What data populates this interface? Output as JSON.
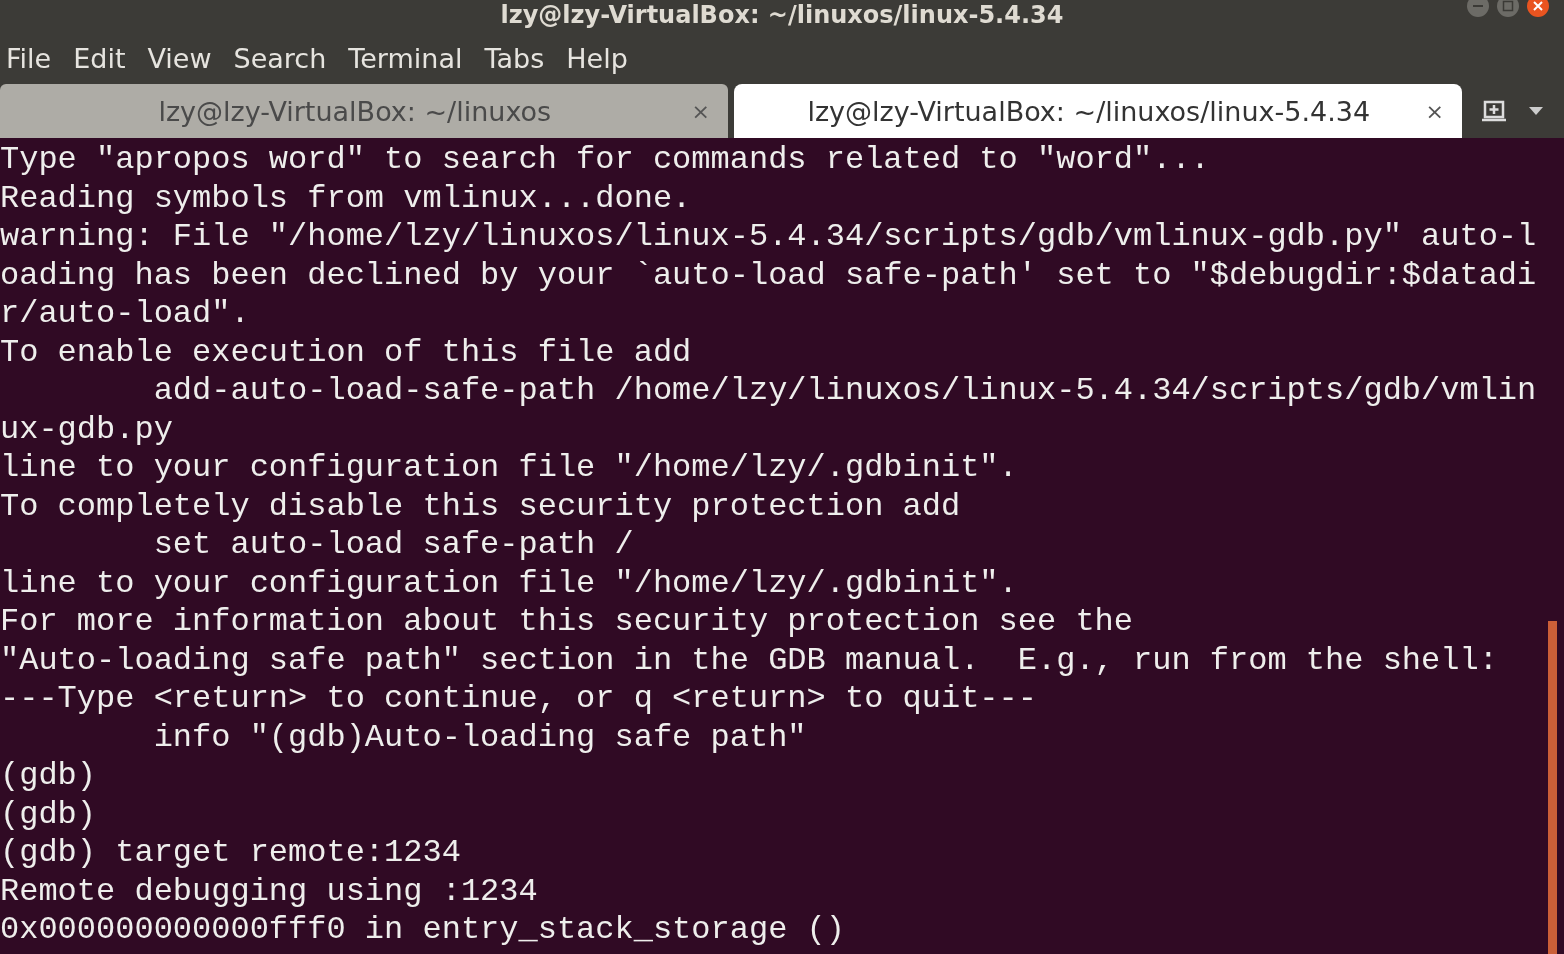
{
  "window": {
    "title": "lzy@lzy-VirtualBox: ~/linuxos/linux-5.4.34"
  },
  "menu": [
    "File",
    "Edit",
    "View",
    "Search",
    "Terminal",
    "Tabs",
    "Help"
  ],
  "tabs": [
    {
      "label": "lzy@lzy-VirtualBox: ~/linuxos",
      "close": "×",
      "selected": false
    },
    {
      "label": "lzy@lzy-VirtualBox: ~/linuxos/linux-5.4.34",
      "close": "×",
      "selected": true
    }
  ],
  "terminal": {
    "lines": [
      "Type \"apropos word\" to search for commands related to \"word\"...",
      "Reading symbols from vmlinux...done.",
      "warning: File \"/home/lzy/linuxos/linux-5.4.34/scripts/gdb/vmlinux-gdb.py\" auto-l",
      "oading has been declined by your `auto-load safe-path' set to \"$debugdir:$datadi",
      "r/auto-load\".",
      "To enable execution of this file add",
      "        add-auto-load-safe-path /home/lzy/linuxos/linux-5.4.34/scripts/gdb/vmlin",
      "ux-gdb.py",
      "line to your configuration file \"/home/lzy/.gdbinit\".",
      "To completely disable this security protection add",
      "        set auto-load safe-path /",
      "line to your configuration file \"/home/lzy/.gdbinit\".",
      "For more information about this security protection see the",
      "\"Auto-loading safe path\" section in the GDB manual.  E.g., run from the shell:",
      "---Type <return> to continue, or q <return> to quit---",
      "        info \"(gdb)Auto-loading safe path\"",
      "(gdb)",
      "(gdb)",
      "(gdb) target remote:1234",
      "Remote debugging using :1234",
      "0x000000000000fff0 in entry_stack_storage ()"
    ]
  }
}
